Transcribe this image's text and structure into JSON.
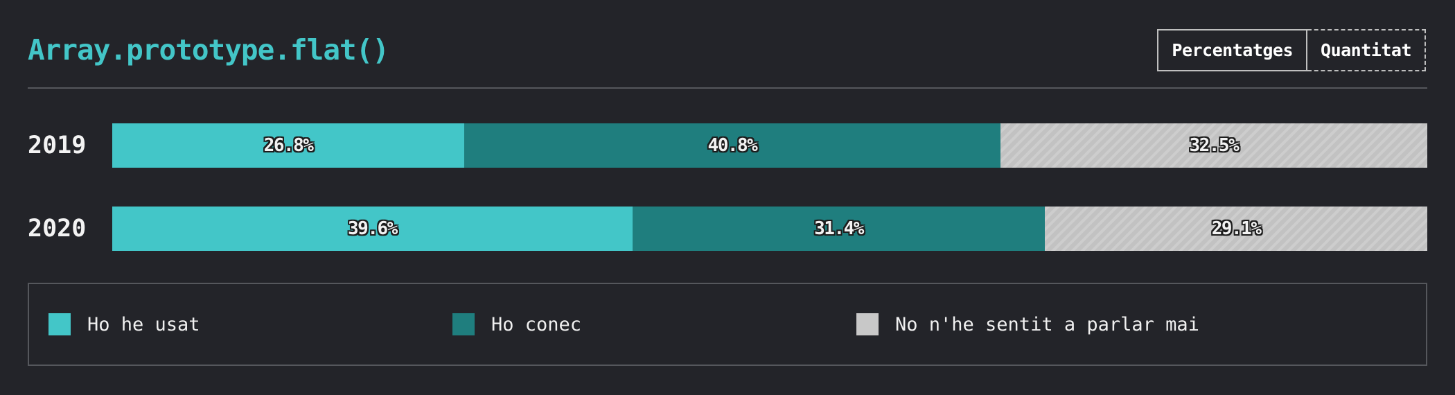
{
  "title": "Array.prototype.flat()",
  "toggle": {
    "percentages_label": "Percentatges",
    "quantity_label": "Quantitat",
    "selected": "Percentatges"
  },
  "colors": {
    "used": "#43c6c8",
    "known": "#1f7e7e",
    "never": "#c8c8c8",
    "accent": "#43c6c8"
  },
  "chart_data": {
    "type": "bar",
    "orientation": "horizontal",
    "stacked": true,
    "unit": "%",
    "categories": [
      "2019",
      "2020"
    ],
    "series": [
      {
        "name": "Ho he usat",
        "key": "used",
        "values": [
          26.8,
          39.6
        ],
        "labels": [
          "26.8%",
          "39.6%"
        ]
      },
      {
        "name": "Ho conec",
        "key": "known",
        "values": [
          40.8,
          31.4
        ],
        "labels": [
          "40.8%",
          "31.4%"
        ]
      },
      {
        "name": "No n'he sentit a parlar mai",
        "key": "never",
        "values": [
          32.5,
          29.1
        ],
        "labels": [
          "32.5%",
          "29.1%"
        ]
      }
    ],
    "legend_position": "bottom"
  }
}
